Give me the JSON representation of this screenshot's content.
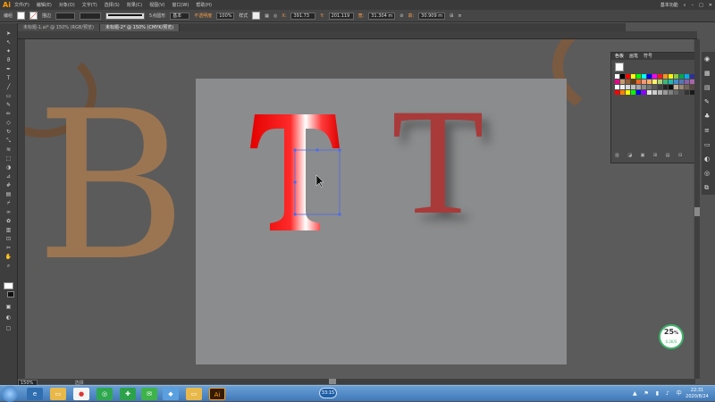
{
  "app": {
    "logo": "Ai"
  },
  "menu": [
    "文件(F)",
    "编辑(E)",
    "对象(O)",
    "文字(T)",
    "选择(S)",
    "效果(C)",
    "视图(V)",
    "窗口(W)",
    "帮助(H)"
  ],
  "menu_right": {
    "workspace": "基本功能",
    "search_icon": "search-icon"
  },
  "control": {
    "selection_label": "编组",
    "stroke_label": "描边",
    "preset_label": "5点圆形",
    "style_label": "基本",
    "opacity_label": "不透明度",
    "opacity_value": "100%",
    "style2_label": "样式",
    "x_label": "X:",
    "x_value": "391.73",
    "y_label": "Y:",
    "y_value": "201.119",
    "w_label": "宽:",
    "w_value": "31.304 m",
    "h_label": "高:",
    "h_value": "30.909 m"
  },
  "tabs": [
    {
      "label": "未标题-1.ai* @ 150% (RGB/预览)",
      "active": false
    },
    {
      "label": "未标题-2* @ 150% (CMYK/预览)",
      "active": true
    }
  ],
  "artwork": {
    "letter_b": "B",
    "letter_t_red": "T",
    "letter_t_gradient": "T"
  },
  "swatch_panel": {
    "tabs": [
      "色板",
      "画笔",
      "符号"
    ]
  },
  "swatch_colors": [
    "#ffffff",
    "#000000",
    "#ff0000",
    "#ffff00",
    "#00ff00",
    "#00ffff",
    "#0000ff",
    "#ff00ff",
    "#ed1c24",
    "#f7941d",
    "#fff200",
    "#8dc63f",
    "#00a651",
    "#00aeef",
    "#2e3192",
    "#92278f",
    "#ec008c",
    "#c69c6d",
    "#8c6239",
    "#603913",
    "#f26522",
    "#f7977a",
    "#fbaf5d",
    "#fff568",
    "#acd373",
    "#3cb878",
    "#1cbbb4",
    "#448ccb",
    "#5574b9",
    "#8560a8",
    "#a864a8",
    "#f06eaa",
    "#ffffff",
    "#f2f2f2",
    "#d9d9d9",
    "#bfbfbf",
    "#a6a6a6",
    "#8c8c8c",
    "#737373",
    "#595959",
    "#404040",
    "#262626",
    "#0d0d0d",
    "#c7b299",
    "#998675",
    "#736357",
    "#534741",
    "#362f2d",
    "#ff0000",
    "#ff7f00",
    "#ffff00",
    "#00ff00",
    "#0000ff",
    "#8b00ff",
    "#e6e6e6",
    "#cccccc",
    "#b3b3b3",
    "#999999",
    "#808080",
    "#666666",
    "#4d4d4d",
    "#333333",
    "#1a1a1a",
    "#000000"
  ],
  "status": {
    "zoom": "150%",
    "tool": "选择"
  },
  "badge": {
    "value": "25",
    "unit": "%",
    "label": "0.2K/S"
  },
  "taskbar": {
    "time": "22:31",
    "date": "2020/8/24",
    "recording": "33:15"
  }
}
